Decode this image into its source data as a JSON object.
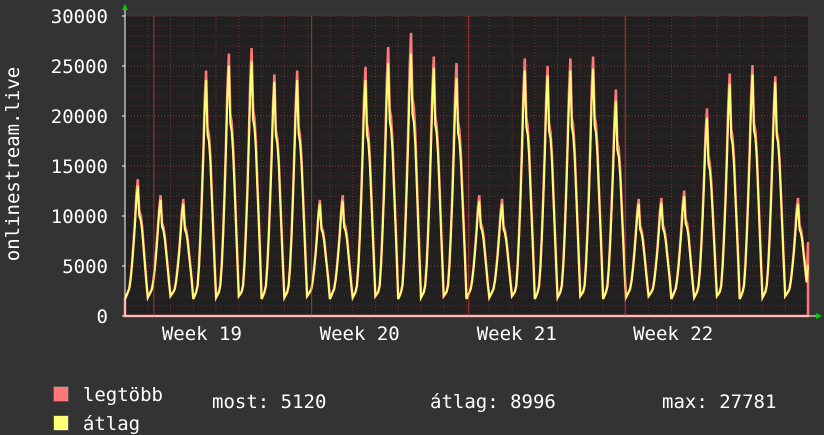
{
  "chart_data": {
    "type": "area",
    "ylabel": "onlinestream.live",
    "ylim": [
      0,
      30000
    ],
    "yticks": [
      0,
      5000,
      10000,
      15000,
      20000,
      25000,
      30000
    ],
    "xticks": [
      "Week 19",
      "Week 20",
      "Week 21",
      "Week 22"
    ],
    "grid": true,
    "days": 30,
    "series": [
      {
        "name": "legtöbb",
        "color": "#ff7777",
        "peaks": [
          14500,
          12800,
          12400,
          26000,
          27800,
          28400,
          25600,
          26000,
          12300,
          12800,
          26400,
          28500,
          30000,
          27500,
          26800,
          12800,
          12400,
          27300,
          26500,
          27300,
          27500,
          24000,
          12400,
          12500,
          13300,
          22000,
          25700,
          26600,
          25400,
          12500
        ],
        "last": 7400
      },
      {
        "name": "átlag",
        "color": "#ffff77",
        "peaks": [
          13800,
          12300,
          11900,
          25000,
          26500,
          27000,
          24800,
          25000,
          11900,
          12200,
          25000,
          26800,
          27800,
          26300,
          25200,
          12200,
          11900,
          26000,
          25500,
          26000,
          26200,
          22800,
          11900,
          12000,
          12700,
          21000,
          24600,
          25600,
          24800,
          11900
        ],
        "last": 5120
      }
    ]
  },
  "legend": {
    "items": [
      {
        "label": "legtöbb",
        "color": "#ff7777"
      },
      {
        "label": "átlag",
        "color": "#ffff77"
      }
    ],
    "stats": {
      "most": "most: 5120",
      "atlag": "átlag: 8996",
      "max": "max: 27781"
    }
  },
  "colors": {
    "background": "#333333",
    "plot": "#202020",
    "grid": "#ff4444",
    "axis": "#ffffff",
    "arrow": "#00cc00"
  }
}
